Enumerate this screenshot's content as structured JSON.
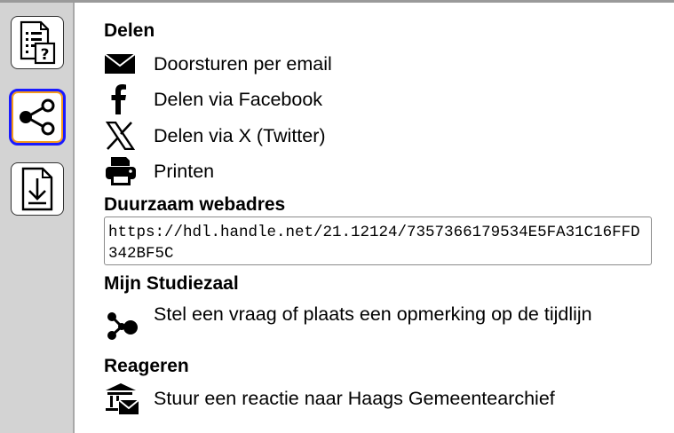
{
  "sidebar": {
    "buttons": [
      {
        "name": "info",
        "icon": "document-question-icon"
      },
      {
        "name": "share",
        "icon": "share-icon",
        "active": true
      },
      {
        "name": "download",
        "icon": "download-icon"
      }
    ],
    "active_border": "#1a1aff",
    "active_accent": "#f59b1c"
  },
  "share": {
    "title": "Delen",
    "items": [
      {
        "label": "Doorsturen per email",
        "icon": "envelope-icon"
      },
      {
        "label": "Delen via Facebook",
        "icon": "facebook-icon"
      },
      {
        "label": "Delen via X (Twitter)",
        "icon": "x-twitter-icon"
      },
      {
        "label": "Printen",
        "icon": "printer-icon"
      }
    ]
  },
  "permalink": {
    "title": "Duurzaam webadres",
    "url": "https://hdl.handle.net/21.12124/7357366179534E5FA31C16FFD342BF5C"
  },
  "studiezaal": {
    "title": "Mijn Studiezaal",
    "item": {
      "label": "Stel een vraag of plaats een opmerking op de tijdlijn",
      "icon": "timeline-share-icon"
    }
  },
  "reageren": {
    "title": "Reageren",
    "item": {
      "label": "Stuur een reactie naar Haags Gemeentearchief",
      "icon": "archive-mail-icon"
    }
  }
}
